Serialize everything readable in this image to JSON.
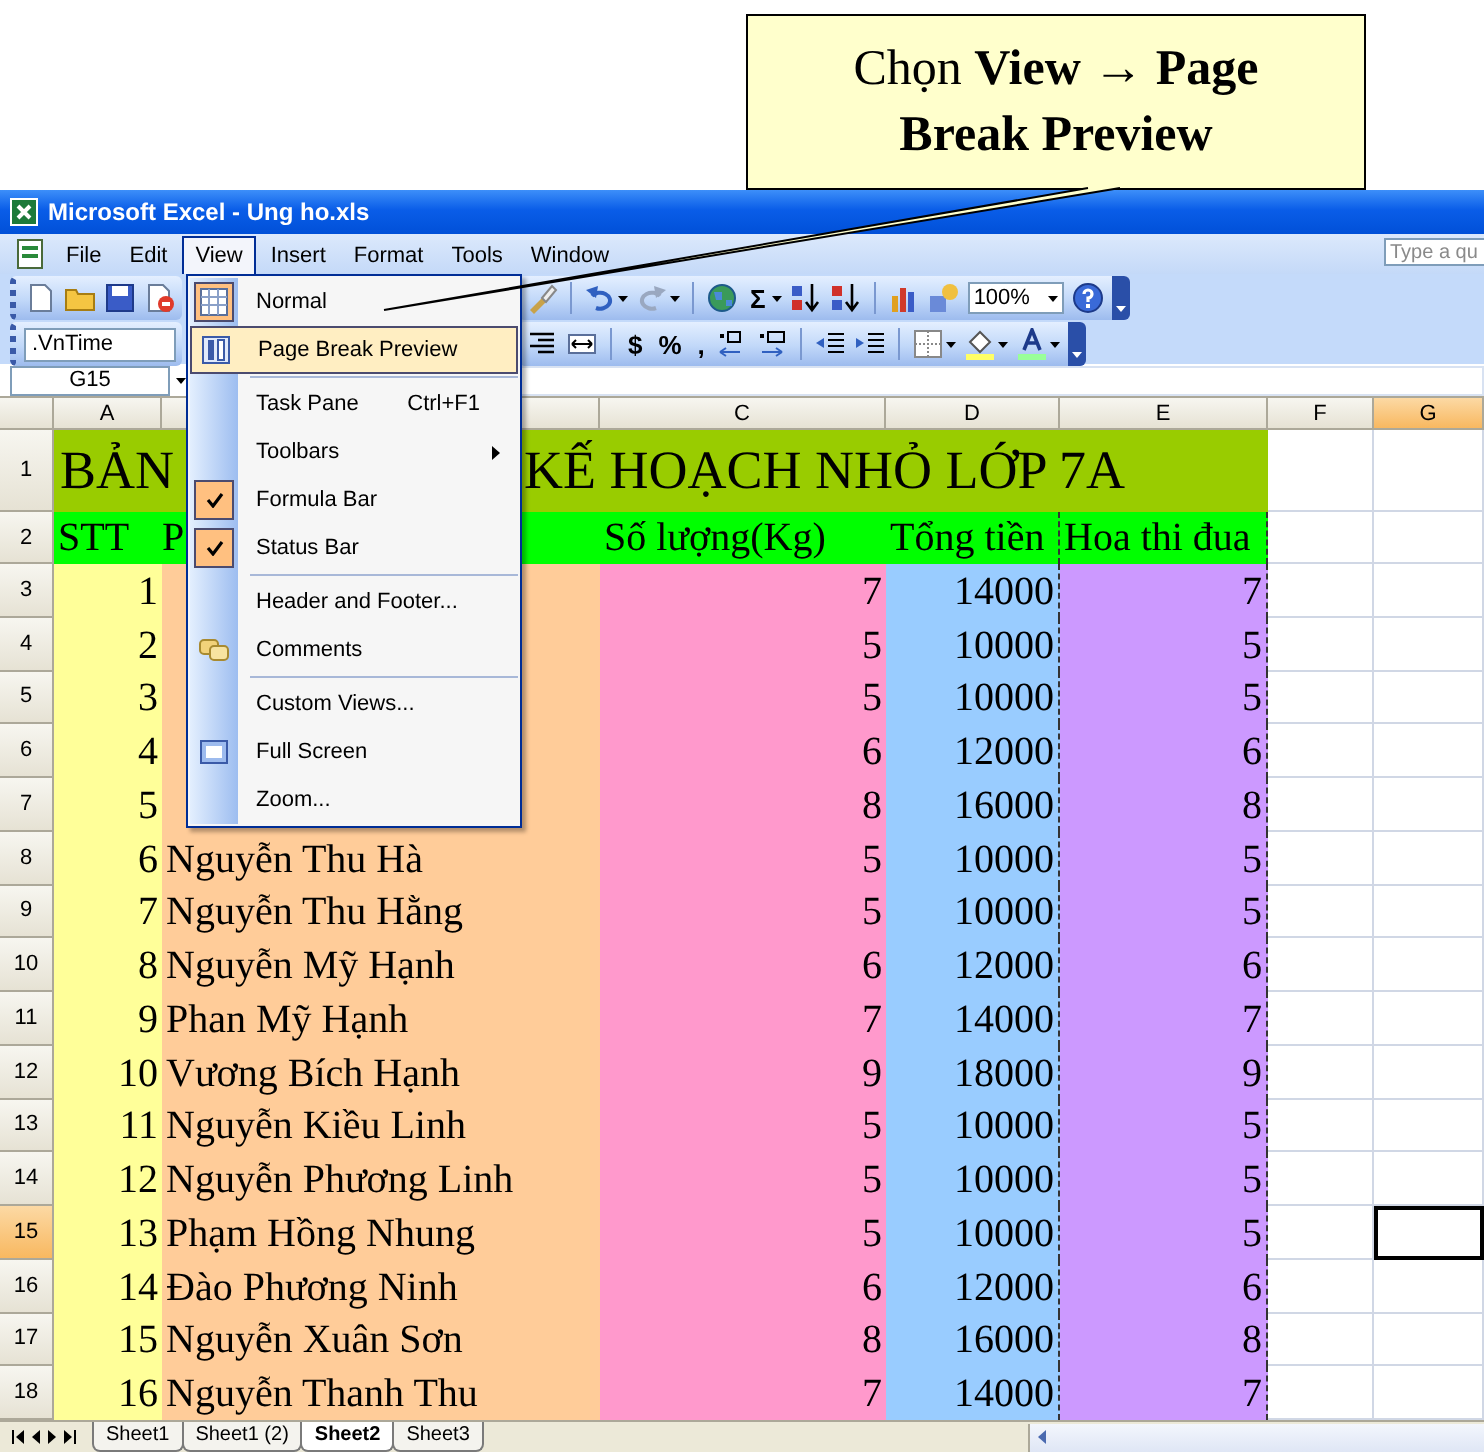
{
  "callout": {
    "text": "Chọn **View** → **Page Break Preview**"
  },
  "window": {
    "title": "Microsoft Excel - Ung ho.xls"
  },
  "menu_bar": {
    "items": [
      {
        "label": "File",
        "selected": false
      },
      {
        "label": "Edit",
        "selected": false
      },
      {
        "label": "View",
        "selected": true
      },
      {
        "label": "Insert",
        "selected": false
      },
      {
        "label": "Format",
        "selected": false
      },
      {
        "label": "Tools",
        "selected": false
      },
      {
        "label": "Window",
        "selected": false
      }
    ],
    "help_box": {
      "placeholder": "Type a qu"
    }
  },
  "view_menu": {
    "items": [
      {
        "label": "Normal",
        "kind": "normal",
        "checked": true,
        "selected": false,
        "separator_before": false,
        "submenu": false
      },
      {
        "label": "Page Break Preview",
        "kind": "page-break",
        "checked": false,
        "selected": true,
        "separator_before": false,
        "submenu": false
      },
      {
        "label": "Task Pane",
        "kind": "plain",
        "shortcut": "Ctrl+F1",
        "checked": false,
        "selected": false,
        "separator_before": true,
        "submenu": false
      },
      {
        "label": "Toolbars",
        "kind": "plain",
        "checked": false,
        "selected": false,
        "separator_before": false,
        "submenu": true
      },
      {
        "label": "Formula Bar",
        "kind": "plain",
        "checked": true,
        "selected": false,
        "separator_before": false,
        "submenu": false
      },
      {
        "label": "Status Bar",
        "kind": "plain",
        "checked": true,
        "selected": false,
        "separator_before": false,
        "submenu": false
      },
      {
        "label": "Header and Footer...",
        "kind": "plain",
        "checked": false,
        "selected": false,
        "separator_before": true,
        "submenu": false
      },
      {
        "label": "Comments",
        "kind": "comments",
        "checked": false,
        "selected": false,
        "separator_before": false,
        "submenu": false
      },
      {
        "label": "Custom Views...",
        "kind": "plain",
        "checked": false,
        "selected": false,
        "separator_before": true,
        "submenu": false
      },
      {
        "label": "Full Screen",
        "kind": "full-screen",
        "checked": false,
        "selected": false,
        "separator_before": false,
        "submenu": false
      },
      {
        "label": "Zoom...",
        "kind": "plain",
        "checked": false,
        "selected": false,
        "separator_before": false,
        "submenu": false
      }
    ]
  },
  "standard_toolbar": {
    "autosum": "Σ",
    "zoom": "100%"
  },
  "formatting_toolbar": {
    "font": ".VnTime",
    "currency": "$",
    "percent": "%",
    "comma": ","
  },
  "formula_bar": {
    "name_box": "G15"
  },
  "columns": [
    {
      "label": "A",
      "selected": false
    },
    {
      "selected": false
    },
    {
      "label": "C",
      "selected": false
    },
    {
      "label": "D",
      "selected": false
    },
    {
      "label": "E",
      "selected": false
    },
    {
      "label": "F",
      "selected": false
    },
    {
      "label": "G",
      "selected": true
    }
  ],
  "rows": [
    {
      "header": "1",
      "selected": false,
      "kind": "title",
      "texts": [
        "BẢN",
        "KẾ HOẠCH NHỎ LỚP 7A"
      ]
    },
    {
      "header": "2",
      "selected": false,
      "kind": "heading",
      "cells": [
        "STT",
        "P",
        "Số lượng(Kg)",
        "Tổng tiền",
        "Hoa thi đua"
      ]
    },
    {
      "header": "3",
      "selected": false,
      "kind": "data",
      "stt": "1",
      "quantity": "7",
      "total": "14000",
      "score": "7"
    },
    {
      "header": "4",
      "selected": false,
      "kind": "data",
      "stt": "2",
      "quantity": "5",
      "total": "10000",
      "score": "5"
    },
    {
      "header": "5",
      "selected": false,
      "kind": "data",
      "stt": "3",
      "quantity": "5",
      "total": "10000",
      "score": "5"
    },
    {
      "header": "6",
      "selected": false,
      "kind": "data",
      "stt": "4",
      "quantity": "6",
      "total": "12000",
      "score": "6"
    },
    {
      "header": "7",
      "selected": false,
      "kind": "data",
      "stt": "5",
      "quantity": "8",
      "total": "16000",
      "score": "8"
    },
    {
      "header": "8",
      "selected": false,
      "kind": "data",
      "stt": "6",
      "name": "Nguyễn Thu Hà",
      "quantity": "5",
      "total": "10000",
      "score": "5"
    },
    {
      "header": "9",
      "selected": false,
      "kind": "data",
      "stt": "7",
      "name": "Nguyễn Thu Hằng",
      "quantity": "5",
      "total": "10000",
      "score": "5"
    },
    {
      "header": "10",
      "selected": false,
      "kind": "data",
      "stt": "8",
      "name": "Nguyễn Mỹ Hạnh",
      "quantity": "6",
      "total": "12000",
      "score": "6"
    },
    {
      "header": "11",
      "selected": false,
      "kind": "data",
      "stt": "9",
      "name": "Phan Mỹ Hạnh",
      "quantity": "7",
      "total": "14000",
      "score": "7"
    },
    {
      "header": "12",
      "selected": false,
      "kind": "data",
      "stt": "10",
      "name": "Vương Bích Hạnh",
      "quantity": "9",
      "total": "18000",
      "score": "9"
    },
    {
      "header": "13",
      "selected": false,
      "kind": "data",
      "stt": "11",
      "name": "Nguyễn Kiều Linh",
      "quantity": "5",
      "total": "10000",
      "score": "5"
    },
    {
      "header": "14",
      "selected": false,
      "kind": "data",
      "stt": "12",
      "name": "Nguyễn Phương Linh",
      "quantity": "5",
      "total": "10000",
      "score": "5"
    },
    {
      "header": "15",
      "selected": true,
      "kind": "data",
      "stt": "13",
      "name": "Phạm Hồng Nhung",
      "quantity": "5",
      "total": "10000",
      "score": "5"
    },
    {
      "header": "16",
      "selected": false,
      "kind": "data",
      "stt": "14",
      "name": "Đào Phương Ninh",
      "quantity": "6",
      "total": "12000",
      "score": "6"
    },
    {
      "header": "17",
      "selected": false,
      "kind": "data",
      "stt": "15",
      "name": "Nguyễn Xuân Sơn",
      "quantity": "8",
      "total": "16000",
      "score": "8"
    },
    {
      "header": "18",
      "selected": false,
      "kind": "data",
      "stt": "16",
      "name": "Nguyễn Thanh Thu",
      "quantity": "7",
      "total": "14000",
      "score": "7"
    }
  ],
  "sheet_tabs": [
    {
      "label": "Sheet1",
      "selected": false
    },
    {
      "label": "Sheet1 (2)",
      "selected": false
    },
    {
      "label": "Sheet2",
      "selected": true
    },
    {
      "label": "Sheet3",
      "selected": false
    }
  ]
}
